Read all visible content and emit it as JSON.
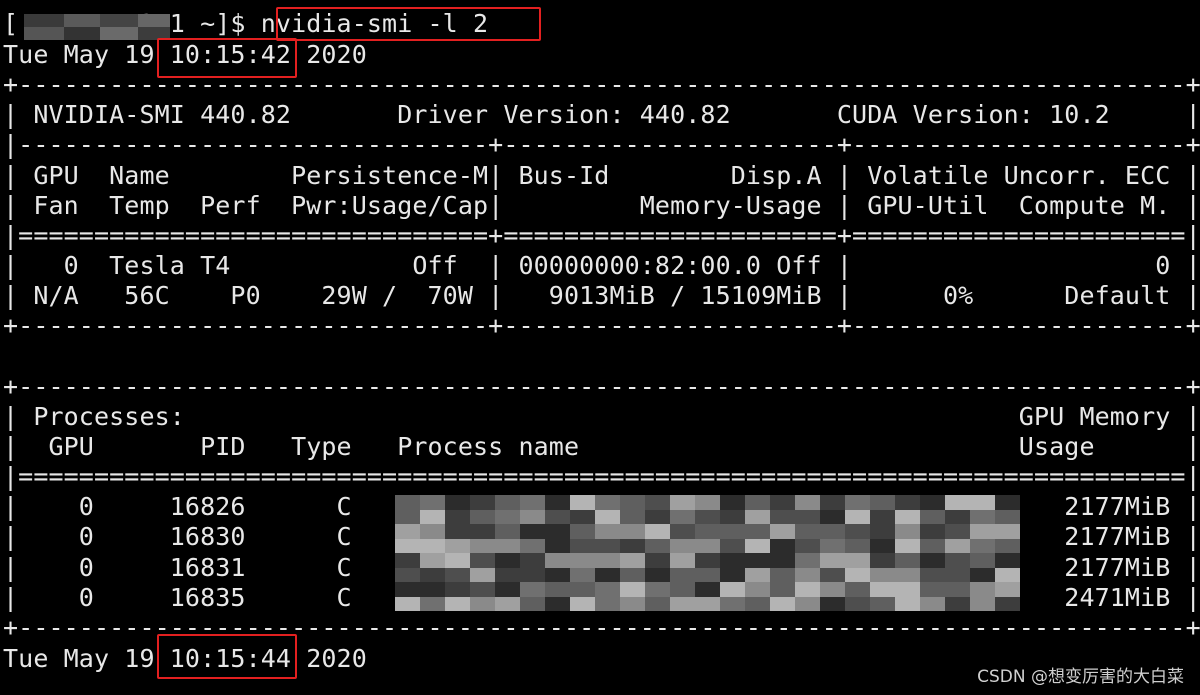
{
  "terminal": {
    "lines": [
      "[        251 ~]$ nvidia-smi -l 2",
      "Tue May 19 10:15:42 2020",
      "+-----------------------------------------------------------------------------+",
      "| NVIDIA-SMI 440.82       Driver Version: 440.82       CUDA Version: 10.2     |",
      "|-------------------------------+----------------------+----------------------+",
      "| GPU  Name        Persistence-M| Bus-Id        Disp.A | Volatile Uncorr. ECC |",
      "| Fan  Temp  Perf  Pwr:Usage/Cap|         Memory-Usage | GPU-Util  Compute M. |",
      "|===============================+======================+======================|",
      "|   0  Tesla T4            Off  | 00000000:82:00.0 Off |                    0 |",
      "| N/A   56C    P0    29W /  70W |   9013MiB / 15109MiB |      0%      Default |",
      "+-------------------------------+----------------------+----------------------+",
      "",
      "+-----------------------------------------------------------------------------+",
      "| Processes:                                                       GPU Memory |",
      "|  GPU       PID   Type   Process name                             Usage      |",
      "|=============================================================================|",
      "|    0     16826      C                                               2177MiB |",
      "|    0     16830      C                                               2177MiB |",
      "|    0     16831      C                                               2177MiB |",
      "|    0     16835      C                                               2471MiB |",
      "+-----------------------------------------------------------------------------+",
      "Tue May 19 10:15:44 2020"
    ]
  },
  "watermark": "CSDN @想变厉害的大白菜",
  "colors": {
    "background": "#000000",
    "text": "#e8e8e8",
    "highlight_box": "#e32020"
  }
}
